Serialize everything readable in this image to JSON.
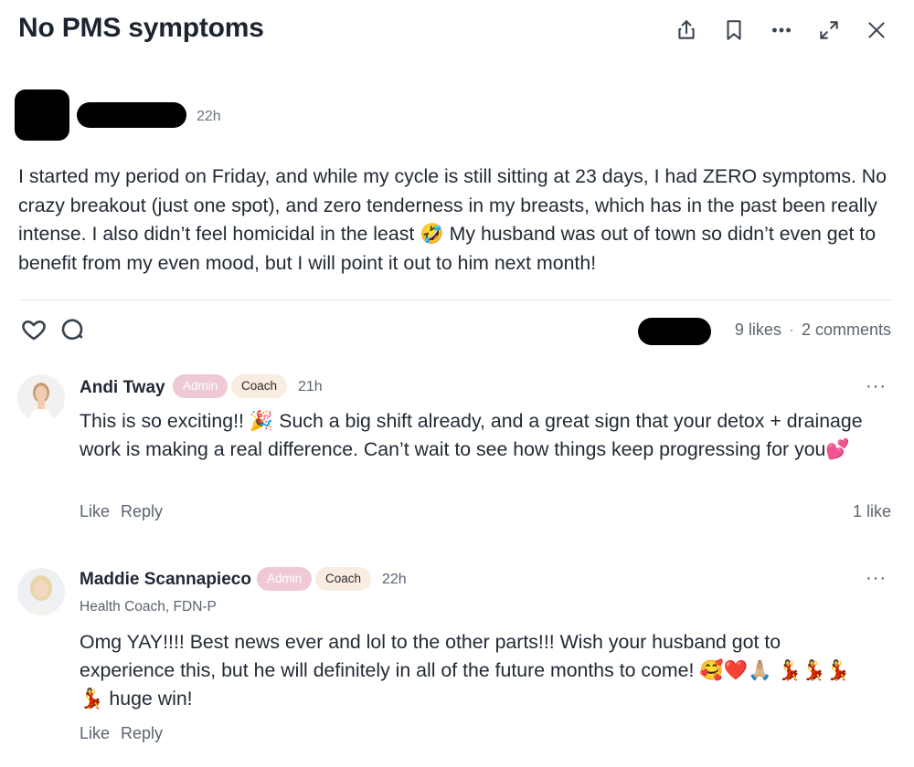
{
  "post": {
    "title": "No PMS symptoms",
    "time": "22h",
    "body": "I started my period on Friday, and while my cycle is still sitting at 23 days, I had ZERO symptoms. No crazy breakout (just one spot), and zero tenderness in my breasts, which has in the past been really intense. I also didn’t feel homicidal in the least 🤣 My husband was out of town so didn’t even get to benefit from my even mood, but I will point it out to him next month!",
    "likes": "9 likes",
    "separator": "·",
    "comments_count": "2 comments"
  },
  "toolbar": {
    "share_icon": "share-icon",
    "bookmark_icon": "bookmark-icon",
    "more_icon": "more-icon",
    "expand_icon": "expand-icon",
    "close_icon": "close-icon"
  },
  "comments": [
    {
      "name": "Andi Tway",
      "badge_admin": "Admin",
      "badge_coach": "Coach",
      "time": "21h",
      "more": "···",
      "text": "This is so exciting!! 🎉 Such a big shift already, and a great sign that your detox + drainage work is making a real difference. Can’t wait to see how things keep progressing for you💕",
      "like_label": "Like",
      "reply_label": "Reply",
      "likes": "1 like"
    },
    {
      "name": "Maddie Scannapieco",
      "badge_admin": "Admin",
      "badge_coach": "Coach",
      "time": "22h",
      "subtitle": "Health Coach, FDN-P",
      "more": "···",
      "text": "Omg YAY!!!! Best news ever and lol to the other parts!!! Wish your husband got to experience this, but he will definitely in all of the future months to come! 🥰❤️🙏🏼 💃💃💃💃 huge win!",
      "like_label": "Like",
      "reply_label": "Reply"
    }
  ],
  "colors": {
    "text": "#1f2733",
    "muted": "#5b6470",
    "admin_badge": "#efc9d3",
    "coach_badge": "#f9ece1",
    "divider": "#e3e5e8"
  }
}
